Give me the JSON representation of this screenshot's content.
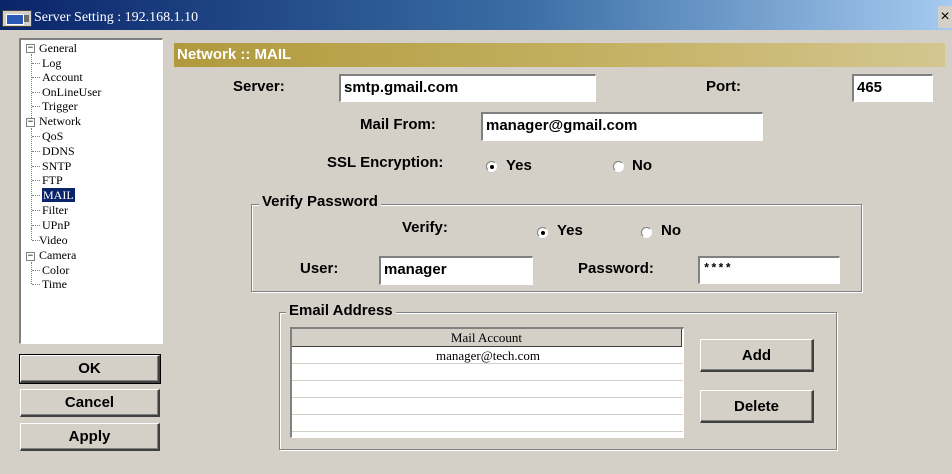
{
  "window": {
    "title": "Server Setting : 192.168.1.10",
    "close_glyph": "×",
    "icon": "server-app-icon"
  },
  "tree": {
    "groups": [
      {
        "label": "General",
        "expanded": true,
        "children": [
          "Log",
          "Account",
          "OnLineUser",
          "Trigger"
        ]
      },
      {
        "label": "Network",
        "expanded": true,
        "children": [
          "QoS",
          "DDNS",
          "SNTP",
          "FTP",
          "MAIL",
          "Filter",
          "UPnP"
        ]
      },
      {
        "label": "Video",
        "expanded": false,
        "children": []
      },
      {
        "label": "Camera",
        "expanded": true,
        "children": [
          "Color",
          "Time"
        ]
      }
    ],
    "selected": "MAIL",
    "expanded_glyph": "−"
  },
  "buttons": {
    "ok": "OK",
    "cancel": "Cancel",
    "apply": "Apply",
    "add": "Add",
    "delete": "Delete"
  },
  "section": {
    "title": "Network :: MAIL"
  },
  "server": {
    "label": "Server:",
    "value": "smtp.gmail.com"
  },
  "port": {
    "label": "Port:",
    "value": "465"
  },
  "mail_from": {
    "label": "Mail From:",
    "value": "manager@gmail.com"
  },
  "ssl": {
    "label": "SSL Encryption:",
    "yes": "Yes",
    "no": "No",
    "selected": "Yes"
  },
  "verify_group": {
    "title": "Verify Password",
    "verify_label": "Verify:",
    "yes": "Yes",
    "no": "No",
    "selected": "Yes",
    "user_label": "User:",
    "user_value": "manager",
    "password_label": "Password:",
    "password_value": "****"
  },
  "email_group": {
    "title": "Email Address",
    "column": "Mail Account",
    "rows": [
      "manager@tech.com",
      "",
      "",
      "",
      "",
      ""
    ]
  }
}
